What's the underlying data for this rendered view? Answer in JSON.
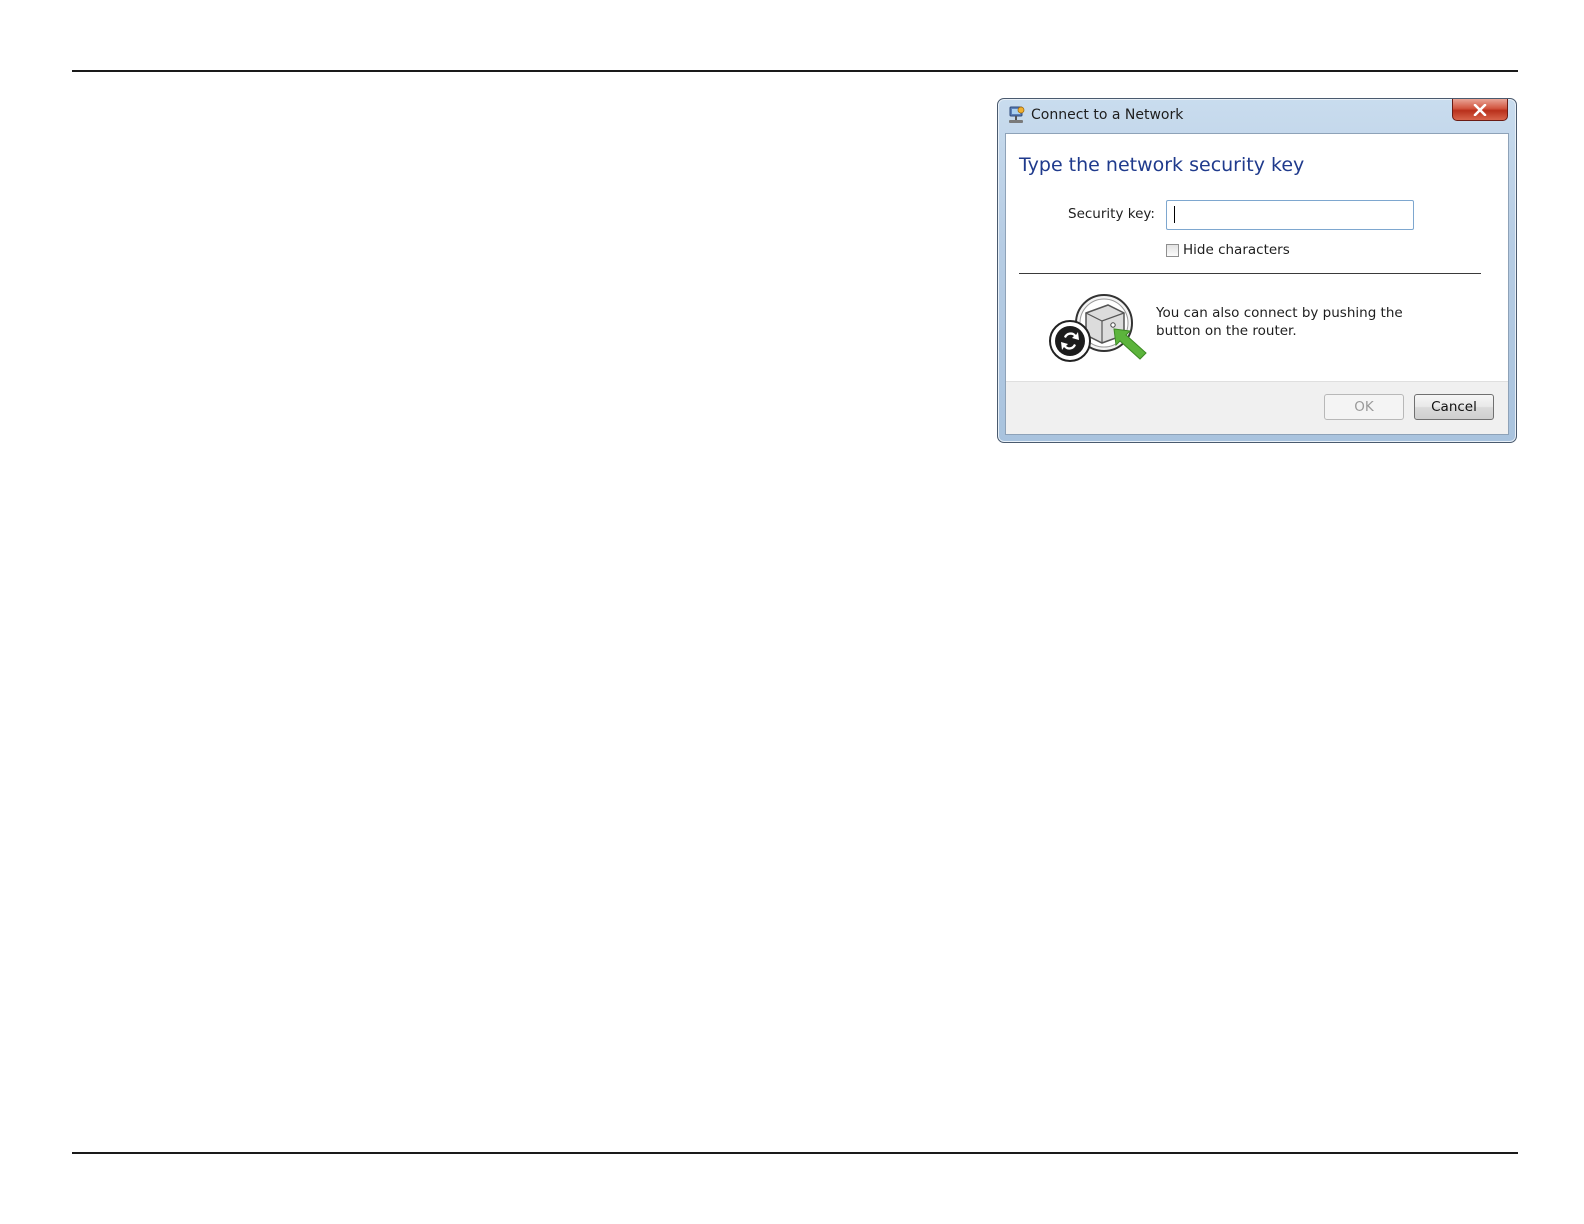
{
  "dialog": {
    "title": "Connect to a Network",
    "close_glyph": "X",
    "heading": "Type the network security key",
    "security_key": {
      "label": "Security key:",
      "value": "",
      "placeholder": ""
    },
    "hide_characters": {
      "label": "Hide characters",
      "checked": false
    },
    "wps_message": "You can also connect by pushing the button on the router.",
    "buttons": {
      "ok": "OK",
      "cancel": "Cancel"
    },
    "icons": {
      "title": "network-icon",
      "close": "close-icon",
      "wps": "wps-router-push-button-icon"
    }
  },
  "colors": {
    "heading": "#1f3a8c",
    "close_button": "#c9412a",
    "wps_arrow": "#5cb43c"
  }
}
